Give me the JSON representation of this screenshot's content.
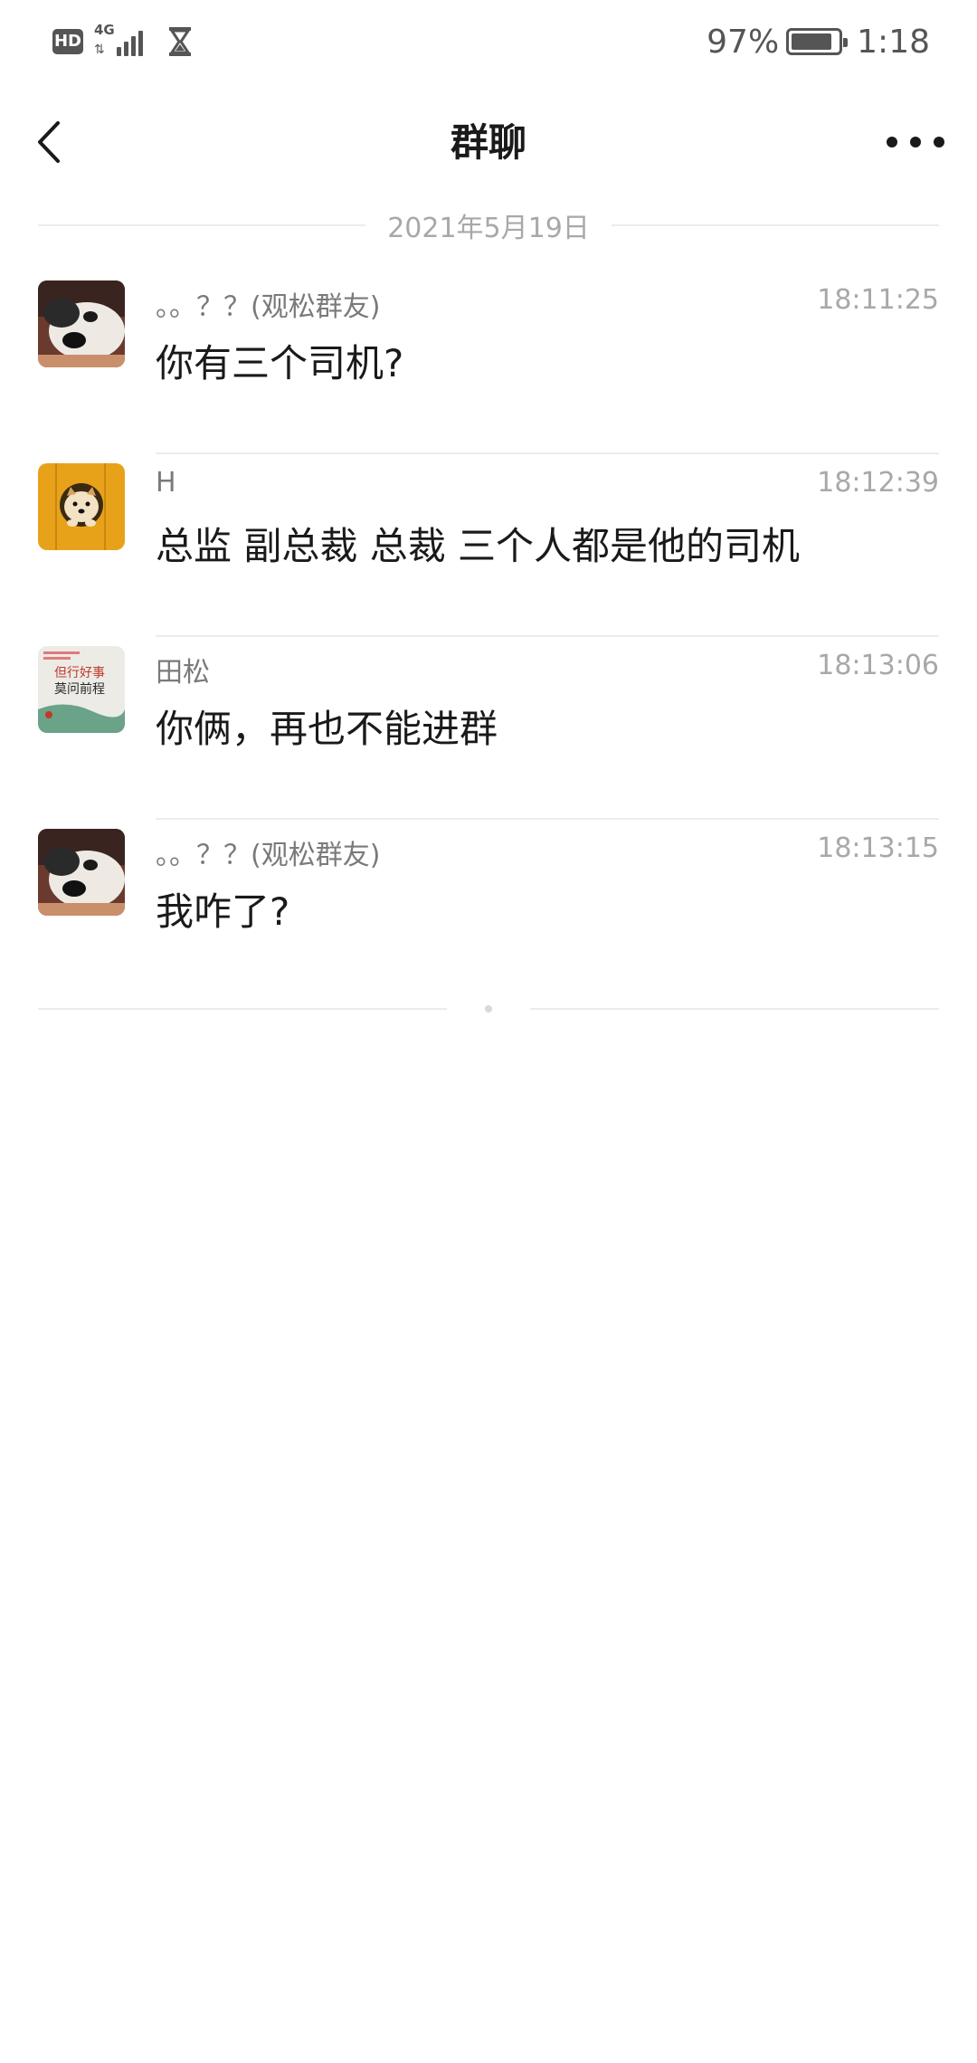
{
  "status_bar": {
    "hd_label": "HD",
    "network_label": "4G",
    "battery_percent": "97%",
    "time": "1:18"
  },
  "header": {
    "title": "群聊",
    "back_icon": "back-chevron-icon",
    "more_icon": "more-dots-icon"
  },
  "date_separator": "2021年5月19日",
  "messages": [
    {
      "sender": "。。？？(观松群友)",
      "time": "18:11:25",
      "text": "你有三个司机?",
      "avatar": "dog-face-avatar"
    },
    {
      "sender": "H",
      "time": "18:12:39",
      "text": "总监 副总裁 总裁 三个人都是他的司机",
      "avatar": "shiba-in-hole-avatar"
    },
    {
      "sender": "田松",
      "time": "18:13:06",
      "text": "你俩，再也不能进群",
      "avatar": "poster-avatar"
    },
    {
      "sender": "。。？？(观松群友)",
      "time": "18:13:15",
      "text": "我咋了?",
      "avatar": "dog-face-avatar"
    }
  ],
  "avatar_poster_text": [
    "但行好事",
    "莫问前程"
  ],
  "colors": {
    "text_primary": "#1a1a1a",
    "text_secondary": "#7a7a7a",
    "text_muted": "#a8a8a8",
    "divider": "#ececec"
  }
}
